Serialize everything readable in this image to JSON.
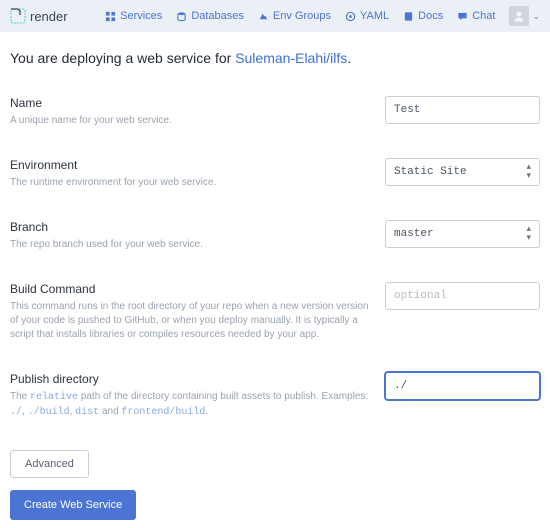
{
  "brand": "render",
  "nav": {
    "services": "Services",
    "databases": "Databases",
    "env_groups": "Env Groups",
    "yaml": "YAML",
    "docs": "Docs",
    "chat": "Chat"
  },
  "heading_prefix": "You are deploying a web service for ",
  "heading_repo": "Suleman-Elahi/ilfs",
  "heading_suffix": ".",
  "fields": {
    "name": {
      "label": "Name",
      "help": "A unique name for your web service.",
      "value": "Test"
    },
    "environment": {
      "label": "Environment",
      "help": "The runtime environment for your web service.",
      "value": "Static Site"
    },
    "branch": {
      "label": "Branch",
      "help": "The repo branch used for your web service.",
      "value": "master"
    },
    "build_command": {
      "label": "Build Command",
      "help": "This command runs in the root directory of your repo when a new version version of your code is pushed to GitHub, or when you deploy manually. It is typically a script that installs libraries or compiles resources needed by your app.",
      "value": "",
      "placeholder": "optional"
    },
    "publish_dir": {
      "label": "Publish directory",
      "help_pre": "The ",
      "help_c1": "relative",
      "help_mid": " path of the directory containing built assets to publish. Examples: ",
      "help_c2": "./",
      "help_c3": "./build",
      "help_c4": "dist",
      "help_and": " and ",
      "help_c5": "frontend/build",
      "help_end": ".",
      "value": "./"
    }
  },
  "buttons": {
    "advanced": "Advanced",
    "create": "Create Web Service"
  }
}
